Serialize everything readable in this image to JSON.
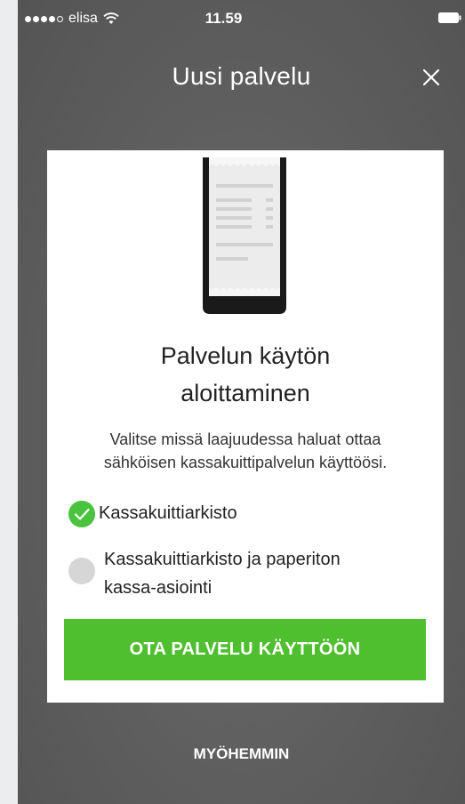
{
  "status_bar": {
    "carrier": "elisa",
    "time": "11.59"
  },
  "header": {
    "title": "Uusi palvelu",
    "close_icon": "close-icon"
  },
  "modal": {
    "illustration_icon": "receipt-phone-illustration",
    "title_line1": "Palvelun käytön",
    "title_line2": "aloittaminen",
    "description_line1": "Valitse missä laajuudessa haluat ottaa",
    "description_line2": "sähköisen kassakuittipalvelun käyttöösi.",
    "options": [
      {
        "label": "Kassakuittiarkisto",
        "selected": true
      },
      {
        "label_line1": "Kassakuittiarkisto ja paperiton",
        "label_line2": "kassa-asiointi",
        "selected": false
      }
    ],
    "primary_button_label": "OTA PALVELU KÄYTTÖÖN"
  },
  "footer": {
    "later_label": "MYÖHEMMIN"
  },
  "colors": {
    "accent_green": "#4fbe2f",
    "check_green": "#4ac43e",
    "overlay_gray": "#5e5e5e"
  }
}
